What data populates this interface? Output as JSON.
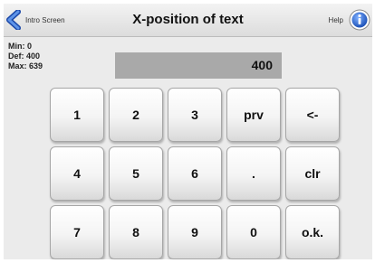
{
  "header": {
    "back_label": "Intro Screen",
    "title": "X-position of text",
    "help_label": "Help",
    "back_icon": "back-arrow-icon",
    "help_icon": "info-icon",
    "accent_color": "#3b6fd0"
  },
  "limits": {
    "min": "Min: 0",
    "def": "Def: 400",
    "max": "Max: 639"
  },
  "display": {
    "value": "400"
  },
  "keypad": {
    "keys": [
      "1",
      "2",
      "3",
      "prv",
      "<-",
      "4",
      "5",
      "6",
      ".",
      "clr",
      "7",
      "8",
      "9",
      "0",
      "o.k."
    ]
  }
}
